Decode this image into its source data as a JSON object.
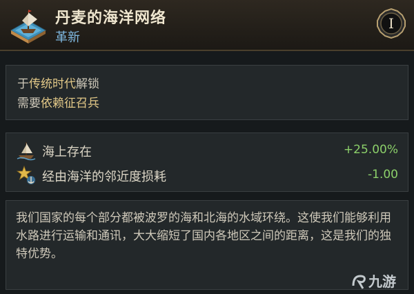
{
  "header": {
    "title": "丹麦的海洋网络",
    "subtitle": "革新",
    "tier": "I",
    "icon": "ship-on-map-icon"
  },
  "unlock": {
    "line1_prefix": "于",
    "line1_highlight": "传统时代",
    "line1_suffix": "解锁",
    "line2_prefix": "需要",
    "line2_highlight": "依赖征召兵"
  },
  "modifiers": [
    {
      "icon": "sailboat-icon",
      "label": "海上存在",
      "value": "+25.00%"
    },
    {
      "icon": "star-anchor-icon",
      "label": "经由海洋的邻近度损耗",
      "value": "-1.00"
    }
  ],
  "description": "我们国家的每个部分都被波罗的海和北海的水域环绕。这使我们能够利用水路进行运输和通讯，大大缩短了国内各地区之间的距离，这是我们的独特优势。",
  "watermark": "九游",
  "colors": {
    "title": "#efe6cf",
    "subtitle": "#7fb8e0",
    "highlight": "#e3c988",
    "positive": "#8cd06a"
  }
}
